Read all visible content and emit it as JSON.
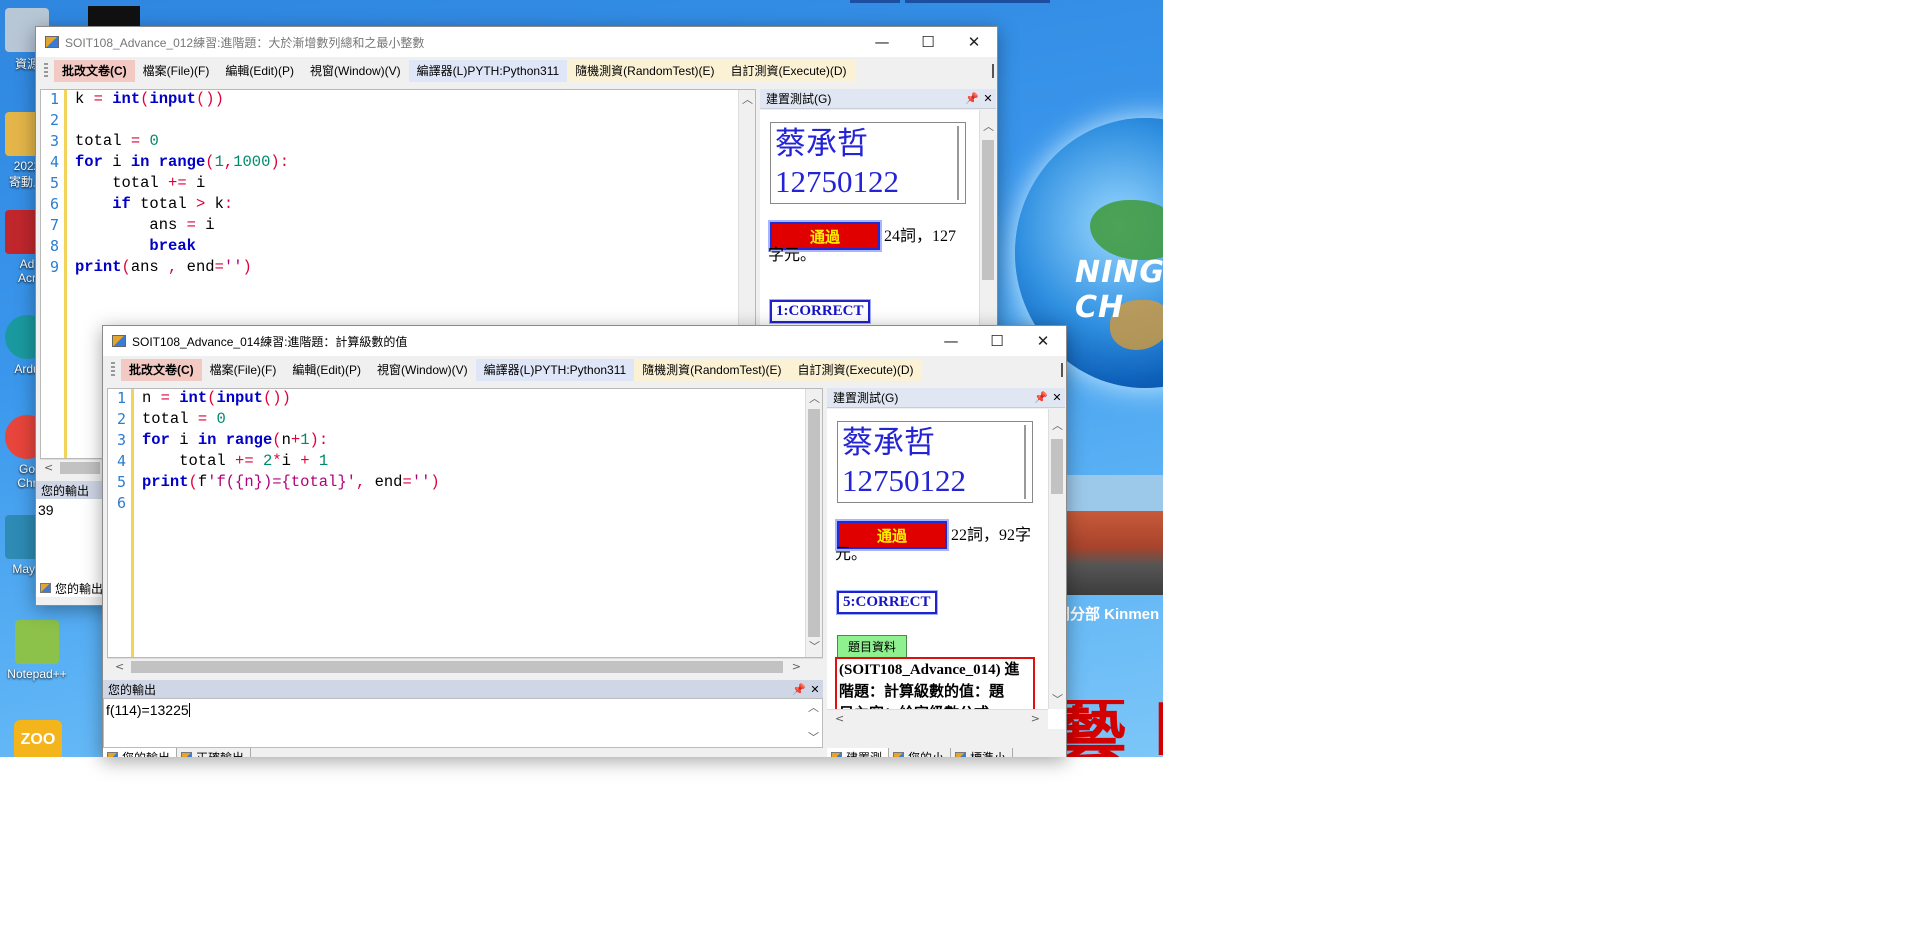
{
  "desktop": {
    "globe_text": "NING CH",
    "branch_text": "門分部 Kinmen",
    "big_red_text": "藝 I",
    "icons": [
      {
        "label": "資源",
        "color": "#b8c7d6"
      },
      {
        "label": "2022\n寄動上",
        "color": "#e4b64a"
      },
      {
        "label": "Ad\nAcr",
        "color": "#c0272d"
      },
      {
        "label": "Ardu",
        "color": "#1a9aa0"
      },
      {
        "label": "Go\nChr",
        "color": "#e8453c"
      },
      {
        "label": "Maya",
        "color": "#2d8bb5"
      },
      {
        "label": "Notepad++",
        "color": "#8cc14a"
      },
      {
        "label": "",
        "color": "#f3b51b"
      }
    ],
    "zoo_label": "ZOO"
  },
  "window1": {
    "title": "SOIT108_Advance_012練習:進階題：大於漸增數列總和之最小整數",
    "menu": {
      "grading": "批改文卷(C)",
      "file": "檔案(File)(F)",
      "edit": "編輯(Edit)(P)",
      "window": "視窗(Window)(V)",
      "compiler": "編譯器(L)PYTH:Python311",
      "random": "隨機測資(RandomTest)(E)",
      "execute": "自訂測資(Execute)(D)"
    },
    "line_numbers": [
      "1",
      "2",
      "3",
      "4",
      "5",
      "6",
      "7",
      "8",
      "9"
    ],
    "code_lines": [
      "k = int(input())",
      "",
      "total = 0",
      "for i in range(1,1000):",
      "    total += i",
      "    if total > k:",
      "        ans = i",
      "        break",
      "print(ans , end='')"
    ],
    "side_panel": {
      "title": "建置測試(G)",
      "name": "蔡承哲",
      "id": "12750122",
      "pass_label": "通過",
      "stats_line1": "24詞，127",
      "stats_line2": "字元。",
      "correct_label": "1:CORRECT"
    },
    "output": {
      "title": "您的輸出",
      "value": "39",
      "tab_label": "您的輸出"
    }
  },
  "window2": {
    "title": "SOIT108_Advance_014練習:進階題：計算級數的值",
    "menu": {
      "grading": "批改文卷(C)",
      "file": "檔案(File)(F)",
      "edit": "編輯(Edit)(P)",
      "window": "視窗(Window)(V)",
      "compiler": "編譯器(L)PYTH:Python311",
      "random": "隨機測資(RandomTest)(E)",
      "execute": "自訂測資(Execute)(D)"
    },
    "line_numbers": [
      "1",
      "2",
      "3",
      "4",
      "5",
      "6"
    ],
    "code_lines": [
      "n = int(input())",
      "total = 0",
      "for i in range(n+1):",
      "    total += 2*i + 1",
      "print(f'f({n})={total}', end='')",
      ""
    ],
    "side_panel": {
      "title": "建置測試(G)",
      "name": "蔡承哲",
      "id": "12750122",
      "pass_label": "通過",
      "stats_line1": "22詞，92字",
      "stats_line2": "元。",
      "correct_label": "5:CORRECT",
      "info_tab": "題目資料",
      "info_text_line1": "(SOIT108_Advance_014) 進",
      "info_text_line2": "階題：計算級數的值：題",
      "info_text_line3": "目內容：給定級數公式"
    },
    "output": {
      "title": "您的輸出",
      "value": "f(114)=13225"
    },
    "bottom_tabs": [
      "您的輸出",
      "正確輸出"
    ],
    "side_tabs": [
      "建置測",
      "您的小",
      "標準小"
    ]
  }
}
